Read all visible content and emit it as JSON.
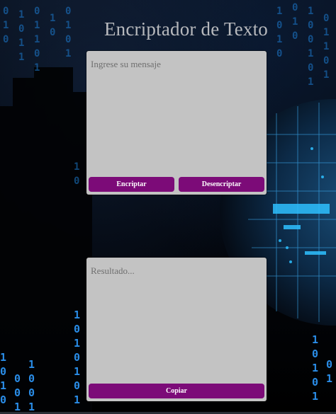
{
  "header": {
    "title": "Encriptador de Texto"
  },
  "input_panel": {
    "placeholder": "Ingrese su mensaje",
    "value": "",
    "encrypt_label": "Encriptar",
    "decrypt_label": "Desencriptar"
  },
  "output_panel": {
    "placeholder": "Resultado...",
    "value": "",
    "copy_label": "Copiar"
  },
  "colors": {
    "button": "#7c0b78",
    "panel": "#c3c3c3",
    "title": "#b7b9bd",
    "matrix_digits": "#1e88e5"
  }
}
